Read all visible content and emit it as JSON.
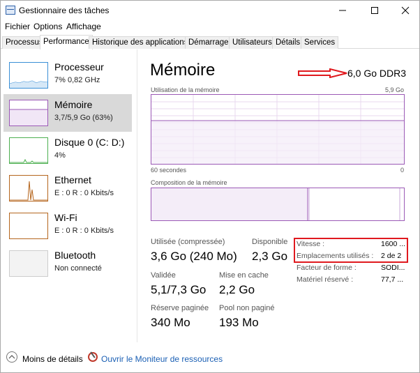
{
  "window": {
    "title": "Gestionnaire des tâches"
  },
  "menu": {
    "items": [
      "Fichier",
      "Options",
      "Affichage"
    ]
  },
  "tabs": [
    "Processus",
    "Performance",
    "Historique des applications",
    "Démarrage",
    "Utilisateurs",
    "Détails",
    "Services"
  ],
  "resources": [
    {
      "name": "Processeur",
      "value": "7% 0,82 GHz",
      "color": "#3a8fd6"
    },
    {
      "name": "Mémoire",
      "value": "3,7/5,9 Go (63%)",
      "color": "#9b59b6"
    },
    {
      "name": "Disque 0 (C: D:)",
      "value": "4%",
      "color": "#4caf50"
    },
    {
      "name": "Ethernet",
      "value": "E : 0 R : 0 Kbits/s",
      "color": "#b5651d"
    },
    {
      "name": "Wi-Fi",
      "value": "E : 0 R : 0 Kbits/s",
      "color": "#b5651d"
    },
    {
      "name": "Bluetooth",
      "value": "Non connecté",
      "color": "#999999"
    }
  ],
  "main": {
    "title": "Mémoire",
    "spec": "6,0 Go DDR3",
    "usage_label": "Utilisation de la mémoire",
    "usage_max": "5,9 Go",
    "time_label": "60 secondes",
    "time_zero": "0",
    "composition_label": "Composition de la mémoire",
    "usage_level": 0.63
  },
  "stats": {
    "used_label": "Utilisée (compressée)",
    "used_value": "3,6 Go (240 Mo)",
    "available_label": "Disponible",
    "available_value": "2,3 Go",
    "committed_label": "Validée",
    "committed_value": "5,1/7,3 Go",
    "cached_label": "Mise en cache",
    "cached_value": "2,2 Go",
    "paged_label": "Réserve paginée",
    "paged_value": "340 Mo",
    "nonpaged_label": "Pool non paginé",
    "nonpaged_value": "193 Mo"
  },
  "details": [
    {
      "key": "Vitesse :",
      "value": "1600 ..."
    },
    {
      "key": "Emplacements utilisés :",
      "value": "2 de 2"
    },
    {
      "key": "Facteur de forme :",
      "value": "SODI..."
    },
    {
      "key": "Matériel réservé :",
      "value": "77,7 ..."
    }
  ],
  "footer": {
    "less_details": "Moins de détails",
    "resource_monitor": "Ouvrir le Moniteur de ressources"
  },
  "colors": {
    "accent": "#9b59b6",
    "highlight": "#e0191e",
    "link": "#1a5fb4"
  }
}
